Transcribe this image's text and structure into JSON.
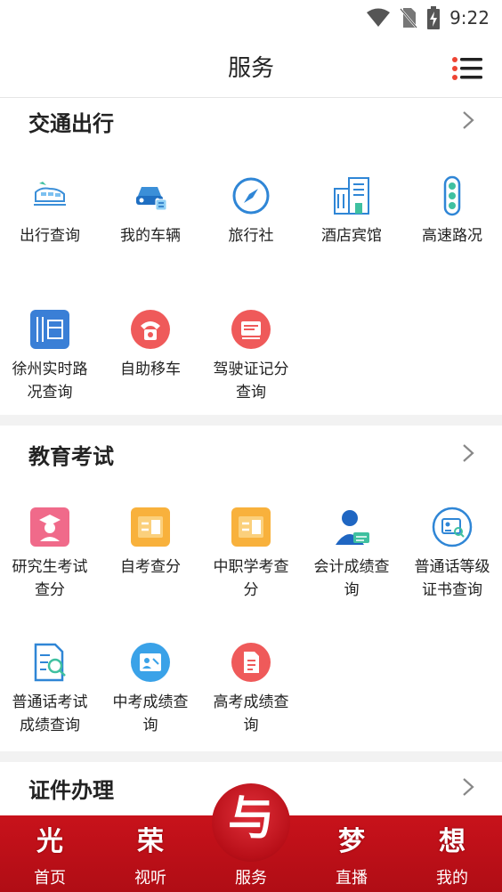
{
  "status_bar": {
    "time": "9:22"
  },
  "header": {
    "title": "服务",
    "menu_icon": "list-menu-icon"
  },
  "sections": [
    {
      "title": "交通出行",
      "items": [
        {
          "label": "出行查询",
          "icon": "train-icon"
        },
        {
          "label": "我的车辆",
          "icon": "car-icon"
        },
        {
          "label": "旅行社",
          "icon": "compass-icon"
        },
        {
          "label": "酒店宾馆",
          "icon": "hotel-building-icon"
        },
        {
          "label": "高速路况",
          "icon": "traffic-light-icon"
        },
        {
          "label": "徐州实时路况查询",
          "label_lines": [
            "徐州实时路",
            "况查询"
          ],
          "icon": "road-map-icon"
        },
        {
          "label": "自助移车",
          "icon": "phone-icon"
        },
        {
          "label": "驾驶证记分查询",
          "label_lines": [
            "驾驶证记分",
            "查询"
          ],
          "icon": "license-card-icon"
        }
      ]
    },
    {
      "title": "教育考试",
      "items": [
        {
          "label_lines": [
            "研究生考试",
            "查分"
          ],
          "icon": "graduate-icon"
        },
        {
          "label": "自考查分",
          "icon": "score-card-icon"
        },
        {
          "label_lines": [
            "中职学考查",
            "分"
          ],
          "icon": "score-card-icon"
        },
        {
          "label_lines": [
            "会计成绩查",
            "询"
          ],
          "icon": "accountant-icon"
        },
        {
          "label_lines": [
            "普通话等级",
            "证书查询"
          ],
          "icon": "certificate-search-icon"
        },
        {
          "label_lines": [
            "普通话考试",
            "成绩查询"
          ],
          "icon": "exam-paper-icon"
        },
        {
          "label_lines": [
            "中考成绩查",
            "询"
          ],
          "icon": "id-photo-icon"
        },
        {
          "label_lines": [
            "高考成绩查",
            "询"
          ],
          "icon": "document-icon"
        }
      ]
    },
    {
      "title": "证件办理"
    }
  ],
  "tabbar": {
    "tabs": [
      {
        "label": "首页",
        "glyph": "光"
      },
      {
        "label": "视听",
        "glyph": "荣"
      },
      {
        "label": "服务",
        "glyph": "与"
      },
      {
        "label": "直播",
        "glyph": "梦"
      },
      {
        "label": "我的",
        "glyph": "想"
      }
    ],
    "color": "#c8121b"
  }
}
